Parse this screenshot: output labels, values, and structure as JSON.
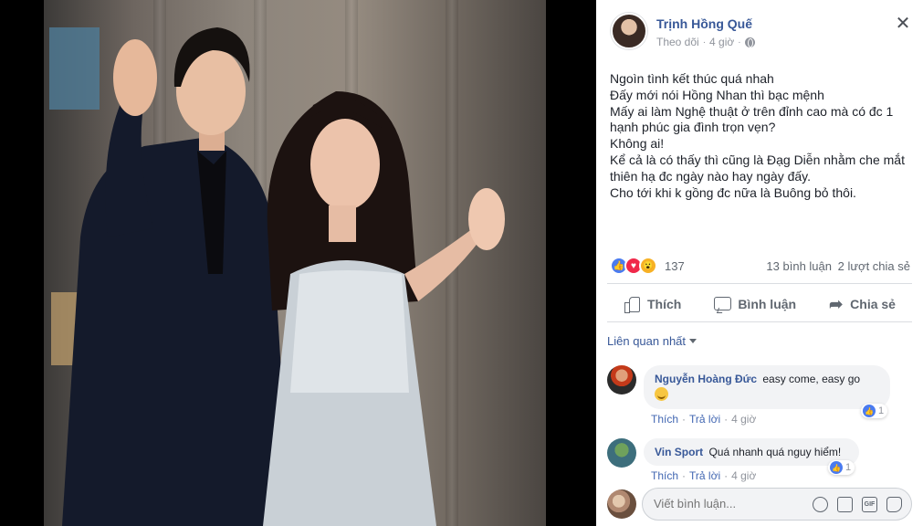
{
  "post": {
    "author": "Trịnh Hồng Quế",
    "follow_label": "Theo dõi",
    "time": "4 giờ",
    "text_lines": [
      "Ngoìn tình kết thúc quá nhah",
      "Đấy mới nói Hồng Nhan thì bạc mệnh",
      "Mấy ai làm Nghệ thuật ở trên đỉnh cao mà có đc 1",
      "hạnh phúc gia đình trọn vẹn?",
      "Không ai!",
      "Kể cả là có thấy thì cũng là Đạg Diễn nhằm che mắt",
      "thiên hạ đc ngày nào hay ngày đấy.",
      "Cho tới khi k gồng đc nữa là Buông bỏ thôi."
    ]
  },
  "stats": {
    "reaction_count": "137",
    "comments": "13 bình luận",
    "shares": "2 lượt chia sẻ"
  },
  "actions": {
    "like": "Thích",
    "comment": "Bình luận",
    "share": "Chia sẻ"
  },
  "filter": {
    "label": "Liên quan nhất"
  },
  "comments": [
    {
      "name": "Nguyễn Hoàng Đức",
      "text": "easy come, easy go",
      "like_link": "Thích",
      "reply_link": "Trả lời",
      "time": "4 giờ",
      "likes": "1"
    },
    {
      "name": "Vin Sport",
      "text": "Quá nhanh quá nguy hiểm!",
      "like_link": "Thích",
      "reply_link": "Trả lời",
      "time": "4 giờ",
      "likes": "1"
    }
  ],
  "composer": {
    "placeholder": "Viết bình luận..."
  },
  "colors": {
    "link": "#385898",
    "like_blue": "#4a7bf0",
    "love_red": "#f0284a",
    "wow_yellow": "#f7b125"
  }
}
